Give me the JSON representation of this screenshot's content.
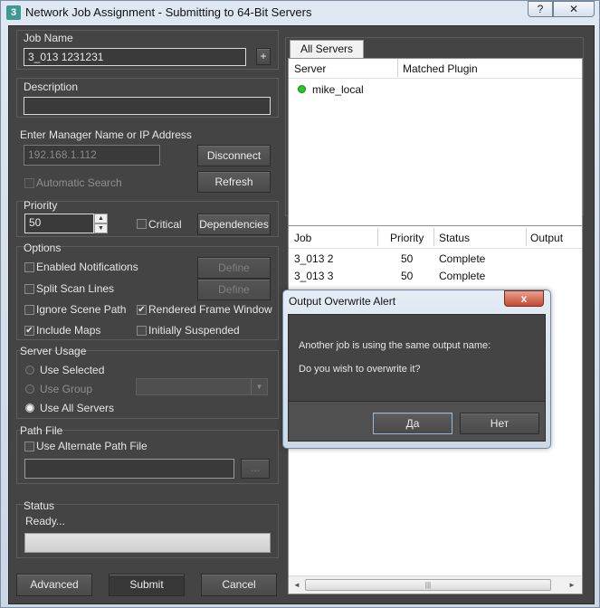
{
  "window": {
    "title": "Network Job Assignment - Submitting to 64-Bit Servers",
    "app_icon": "3",
    "help_label": "?",
    "close_label": "✕"
  },
  "job_name": {
    "label": "Job Name",
    "value": "3_013 1231231",
    "add_label": "+"
  },
  "description": {
    "label": "Description",
    "value": ""
  },
  "manager": {
    "label": "Enter Manager Name or IP Address",
    "value": "192.168.1.112",
    "disconnect_label": "Disconnect",
    "refresh_label": "Refresh",
    "auto_search_label": "Automatic Search"
  },
  "priority": {
    "label": "Priority",
    "value": "50",
    "critical_label": "Critical",
    "dependencies_label": "Dependencies"
  },
  "options": {
    "label": "Options",
    "enabled_notifications": "Enabled Notifications",
    "split_scan_lines": "Split Scan Lines",
    "ignore_scene_path": "Ignore Scene Path",
    "include_maps": "Include Maps",
    "rendered_frame_window": "Rendered Frame Window",
    "initially_suspended": "Initially Suspended",
    "define_label": "Define",
    "check_mark": "✔"
  },
  "server_usage": {
    "label": "Server Usage",
    "use_selected": "Use Selected",
    "use_group": "Use Group",
    "use_all_servers": "Use All Servers",
    "dropdown_arrow": "▼"
  },
  "path_file": {
    "label": "Path File",
    "use_alternate": "Use Alternate Path File",
    "browse_label": "..."
  },
  "status": {
    "label": "Status",
    "text": "Ready..."
  },
  "footer": {
    "advanced_label": "Advanced",
    "submit_label": "Submit",
    "cancel_label": "Cancel"
  },
  "servers": {
    "tab_label": "All Servers",
    "columns": [
      "Server",
      "Matched Plugin"
    ],
    "rows": [
      {
        "name": "mike_local",
        "status_color": "#22cc22"
      }
    ]
  },
  "jobs": {
    "columns": [
      "Job",
      "Priority",
      "Status",
      "Output"
    ],
    "rows": [
      {
        "job": "3_013 2",
        "priority": "50",
        "status": "Complete"
      },
      {
        "job": "3_013 3",
        "priority": "50",
        "status": "Complete"
      }
    ],
    "scroll_left": "◄",
    "scroll_right": "►",
    "scroll_grip": "|||"
  },
  "alert": {
    "title": "Output Overwrite Alert",
    "line1": "Another job is using the same output name:",
    "line2": "Do you wish to overwrite it?",
    "yes_label": "Да",
    "no_label": "Нет",
    "close_label": "x"
  },
  "colors": {
    "panel": "#444444",
    "server_online": "#22cc22"
  }
}
